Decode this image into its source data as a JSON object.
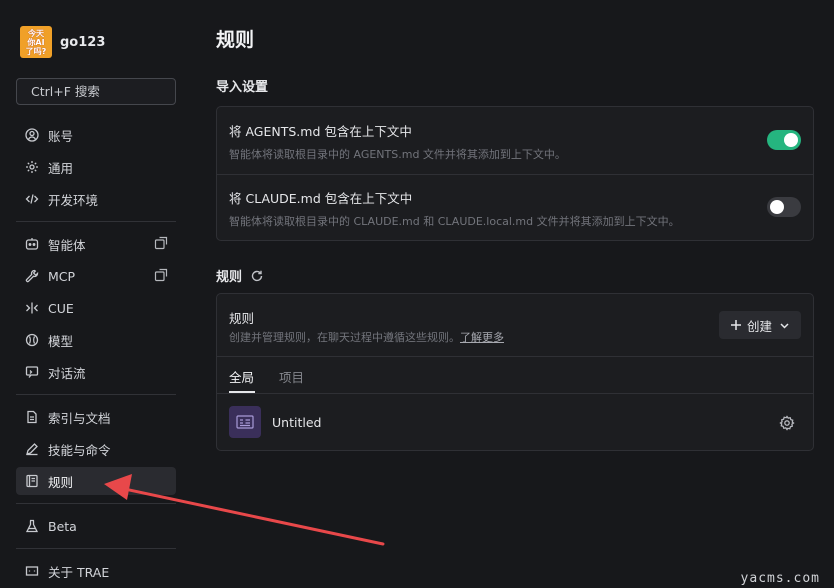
{
  "profile": {
    "avatar_lines": [
      "今天",
      "你AI",
      "了吗?"
    ],
    "username": "go123"
  },
  "search": {
    "label": "Ctrl+F 搜索"
  },
  "nav": {
    "account": "账号",
    "general": "通用",
    "dev_env": "开发环境",
    "agents": "智能体",
    "mcp": "MCP",
    "cue": "CUE",
    "models": "模型",
    "conversation_flow": "对话流",
    "index_docs": "索引与文档",
    "skills_commands": "技能与命令",
    "rules": "规则",
    "beta": "Beta",
    "about": "关于 TRAE"
  },
  "main": {
    "title": "规则",
    "import_section": "导入设置",
    "agents_md": {
      "title": "将 AGENTS.md 包含在上下文中",
      "desc": "智能体将读取根目录中的 AGENTS.md 文件并将其添加到上下文中。",
      "enabled": true
    },
    "claude_md": {
      "title": "将 CLAUDE.md 包含在上下文中",
      "desc": "智能体将读取根目录中的 CLAUDE.md 和 CLAUDE.local.md 文件并将其添加到上下文中。",
      "enabled": false
    },
    "rules_section": "规则",
    "rules_card": {
      "title": "规则",
      "desc": "创建并管理规则，在聊天过程中遵循这些规则。",
      "learn_more": "了解更多",
      "create_label": "创建",
      "tabs": [
        "全局",
        "项目"
      ],
      "items": [
        {
          "name": "Untitled"
        }
      ]
    }
  },
  "colors": {
    "toggle_on": "#25b57f",
    "toggle_off": "#3a3b40",
    "arrow": "#e8484a",
    "rule_icon_bg": "#3a2f5a"
  },
  "watermark": "yacms.com"
}
